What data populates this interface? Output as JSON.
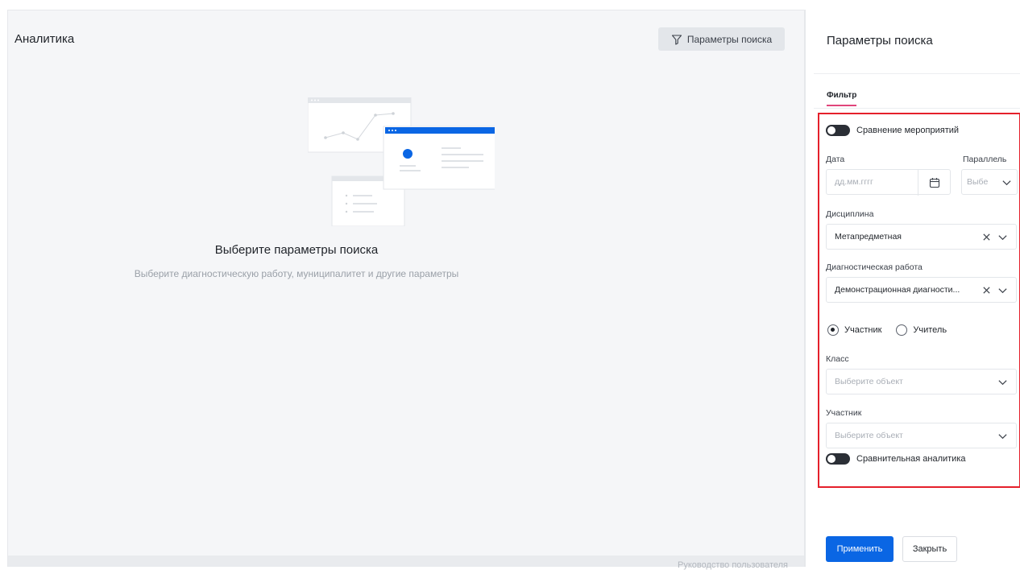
{
  "main": {
    "title": "Аналитика",
    "params_button": "Параметры поиска",
    "empty_title": "Выберите параметры поиска",
    "empty_subtitle": "Выберите диагностическую работу, муниципалитет и другие параметры",
    "footer_link": "Руководство пользователя"
  },
  "panel": {
    "title": "Параметры поиска",
    "tab": "Фильтр",
    "compare_events_label": "Сравнение мероприятий",
    "date_label": "Дата",
    "date_placeholder": "дд.мм.гггг",
    "parallel_label": "Параллель",
    "parallel_placeholder": "Выбе",
    "discipline_label": "Дисциплина",
    "discipline_value": "Метапредметная",
    "work_label": "Диагностическая работа",
    "work_value": "Демонстрационная диагности...",
    "radio_participant": "Участник",
    "radio_teacher": "Учитель",
    "class_label": "Класс",
    "class_placeholder": "Выберите объект",
    "participant_label": "Участник",
    "participant_placeholder": "Выберите объект",
    "comparative_label": "Сравнительная аналитика",
    "apply_button": "Применить",
    "close_button": "Закрыть"
  },
  "colors": {
    "accent": "#0a66e4",
    "tab_underline": "#e0457b",
    "highlight_box": "#e5202b"
  }
}
